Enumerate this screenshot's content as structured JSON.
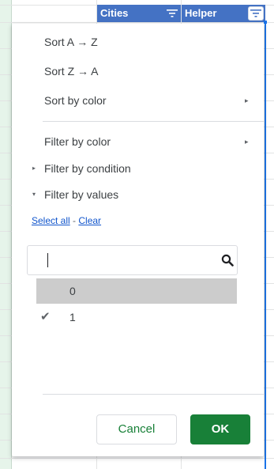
{
  "header": {
    "col_cities": "Cities",
    "col_helper": "Helper"
  },
  "menu": {
    "sort_az": "Sort A → Z",
    "sort_za": "Sort Z → A",
    "sort_by_color": "Sort by color",
    "filter_by_color": "Filter by color",
    "filter_by_condition": "Filter by condition",
    "filter_by_values": "Filter by values",
    "submenu_arrow": "▸",
    "collapsed_triangle": "▸",
    "expanded_triangle": "▾"
  },
  "links": {
    "select_all": "Select all",
    "separator": " - ",
    "clear": "Clear"
  },
  "search": {
    "value": "",
    "icon": "search-icon"
  },
  "values": [
    {
      "label": "0",
      "checked": false,
      "highlighted": true
    },
    {
      "label": "1",
      "checked": true,
      "highlighted": false
    }
  ],
  "check_glyph": "✔",
  "buttons": {
    "cancel": "Cancel",
    "ok": "OK"
  },
  "colors": {
    "header_blue": "#4472c4",
    "ok_green": "#188038",
    "link_blue": "#1155cc",
    "selection_blue": "#1a73e8"
  }
}
